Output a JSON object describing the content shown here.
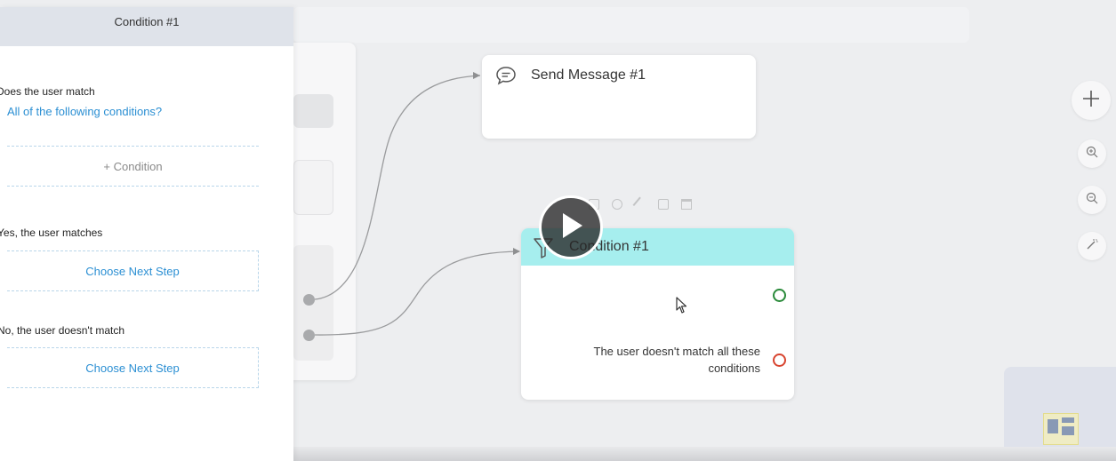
{
  "panel": {
    "header_title": "Condition #1",
    "question_label": "Does the user match",
    "match_mode_link": "All of the following conditions?",
    "add_condition_label": "+ Condition",
    "yes_label": "Yes, the user matches",
    "yes_next_step": "Choose Next Step",
    "no_label": "No, the user doesn't match",
    "no_next_step": "Choose Next Step"
  },
  "nodes": {
    "send_message": {
      "title": "Send Message #1",
      "icon": "chat-bubble-icon"
    },
    "condition": {
      "title": "Condition #1",
      "icon": "filter-icon",
      "no_output_text": "The user doesn't match all these conditions",
      "yes_color": "#2a8a3a",
      "no_color": "#d8442f",
      "header_color": "#a6eeee"
    }
  },
  "controls": {
    "add": "plus-icon",
    "zoom_in": "zoom-in-icon",
    "zoom_out": "zoom-out-icon",
    "magic": "magic-wand-icon"
  },
  "overlay": {
    "play": "play-icon"
  },
  "colors": {
    "link": "#2b8fd3",
    "accent": "#a6eeee"
  }
}
